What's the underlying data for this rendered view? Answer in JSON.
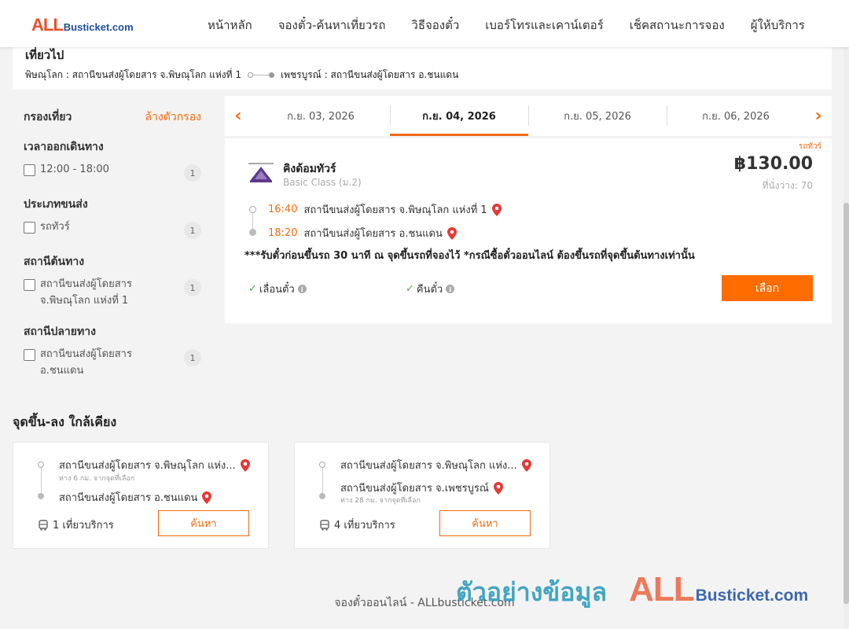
{
  "header": {
    "logo_all": "ALL",
    "logo_rest": "Busticket.com",
    "nav": [
      "หน้าหลัก",
      "จองตั๋ว-ค้นหาเที่ยวรถ",
      "วิธีจองตั๋ว",
      "เบอร์โทรและเคาน์เตอร์",
      "เช็คสถานะการจอง",
      "ผู้ให้บริการ"
    ]
  },
  "route": {
    "trip_label": "เที่ยวไป",
    "origin": "พิษณุโลก : สถานีขนส่งผู้โดยสาร จ.พิษณุโลก แห่งที่ 1",
    "destination": "เพชรบูรณ์ : สถานีขนส่งผู้โดยสาร อ.ชนแดน"
  },
  "filters": {
    "title": "กรองเที่ยว",
    "clear": "ล้างตัวกรอง",
    "groups": [
      {
        "title": "เวลาออกเดินทาง",
        "items": [
          {
            "label": "12:00 - 18:00",
            "count": "1"
          }
        ]
      },
      {
        "title": "ประเภทขนส่ง",
        "items": [
          {
            "label": "รถทัวร์",
            "count": "1"
          }
        ]
      },
      {
        "title": "สถานีต้นทาง",
        "items": [
          {
            "label": "สถานีขนส่งผู้โดยสาร จ.พิษณุโลก แห่งที่ 1",
            "count": "1"
          }
        ]
      },
      {
        "title": "สถานีปลายทาง",
        "items": [
          {
            "label": "สถานีขนส่งผู้โดยสาร อ.ชนแดน",
            "count": "1"
          }
        ]
      }
    ]
  },
  "dates": [
    "ก.ย. 03, 2026",
    "ก.ย. 04, 2026",
    "ก.ย. 05, 2026",
    "ก.ย. 06, 2026"
  ],
  "trip": {
    "tag": "รถทัวร์",
    "operator": "คิงด้อมทัวร์",
    "class": "Basic Class (ม.2)",
    "price": "฿130.00",
    "seats": "ที่นั่งว่าง: 70",
    "depart_time": "16:40",
    "depart_station": "สถานีขนส่งผู้โดยสาร จ.พิษณุโลก แห่งที่ 1",
    "arrive_time": "18:20",
    "arrive_station": "สถานีขนส่งผู้โดยสาร อ.ชนแดน",
    "note": "***รับตั๋วก่อนขึ้นรถ 30 นาที ณ จุดขึ้นรถที่จองไว้ *กรณีซื้อตั๋วออนไลน์ ต้องขึ้นรถที่จุดขึ้นต้นทางเท่านั้น",
    "reschedule": "เลื่อนตั๋ว",
    "refund": "คืนตั๋ว",
    "select": "เลือก"
  },
  "nearby": {
    "title": "จุดขึ้น-ลง ใกล้เคียง",
    "cards": [
      {
        "from": "สถานีขนส่งผู้โดยสาร จ.พิษณุโลก แห่ง...",
        "from_sub": "ห่าง 6 กม. จากจุดที่เลือก",
        "to": "สถานีขนส่งผู้โดยสาร อ.ชนแดน",
        "to_sub": "",
        "services": "1 เที่ยวบริการ",
        "button": "ค้นหา"
      },
      {
        "from": "สถานีขนส่งผู้โดยสาร จ.พิษณุโลก แห่ง...",
        "from_sub": "",
        "to": "สถานีขนส่งผู้โดยสาร จ.เพชรบูรณ์",
        "to_sub": "ห่าง 28 กม. จากจุดที่เลือก",
        "services": "4 เที่ยวบริการ",
        "button": "ค้นหา"
      }
    ]
  },
  "footer": "จองตั๋วออนไลน์ - ALLbusticket.com",
  "watermark": {
    "text": "ตัวอย่างข้อมูล",
    "all": "ALL",
    "rest": "Busticket.com"
  },
  "colors": {
    "accent": "#f26b0f",
    "button": "#ff6c00",
    "brand_blue": "#1c4f9c",
    "pin": "#e53935",
    "check": "#4caf50"
  }
}
